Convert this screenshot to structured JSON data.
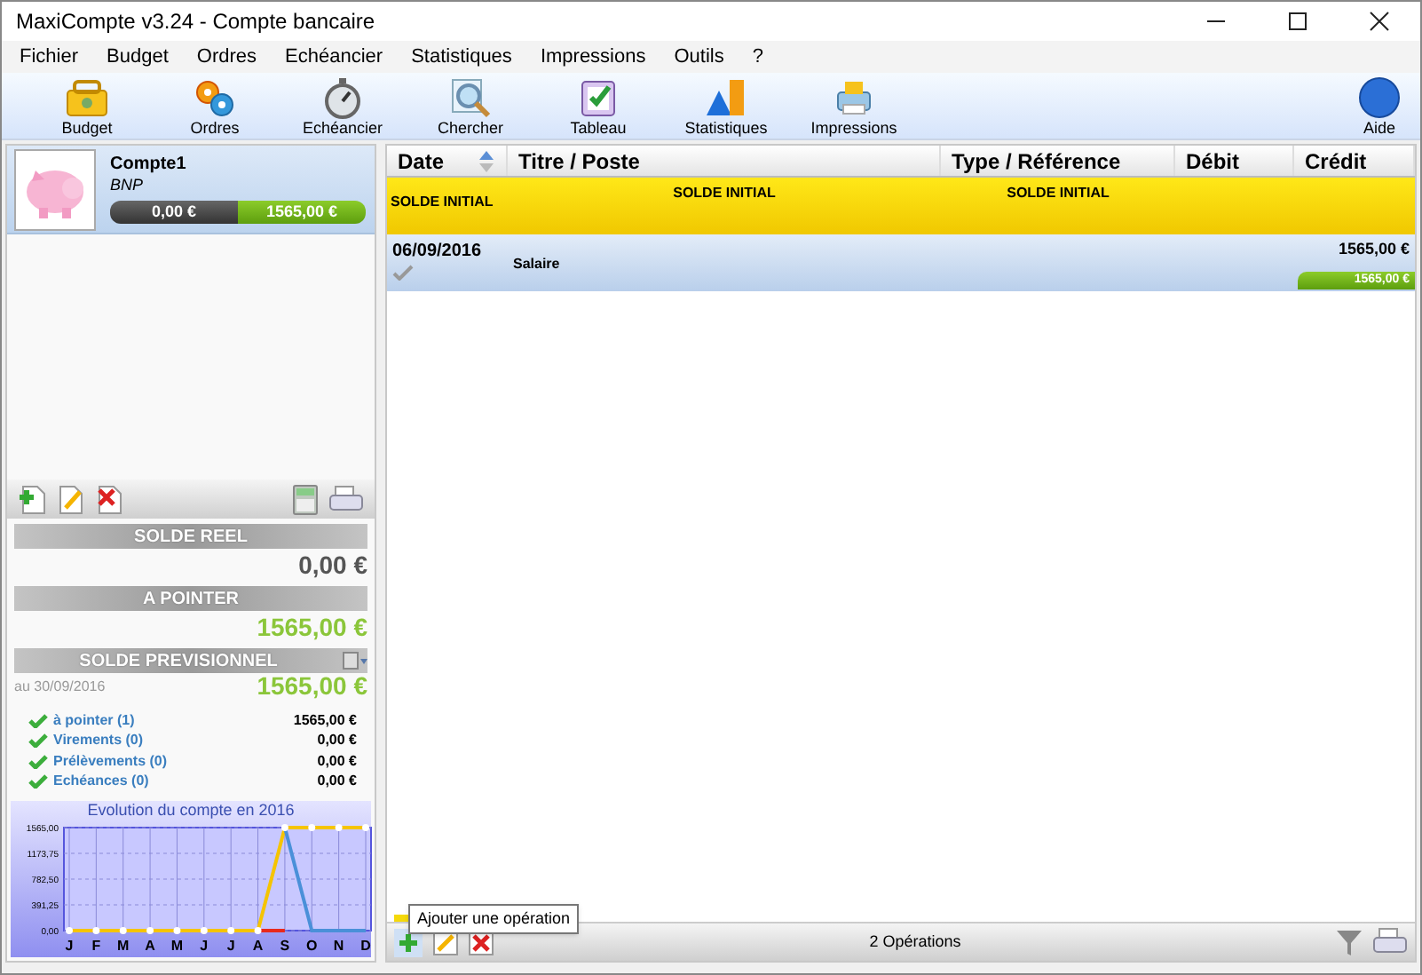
{
  "window": {
    "title": "MaxiCompte v3.24 - Compte bancaire"
  },
  "menu": [
    "Fichier",
    "Budget",
    "Ordres",
    "Echéancier",
    "Statistiques",
    "Impressions",
    "Outils",
    "?"
  ],
  "toolbar": [
    "Budget",
    "Ordres",
    "Echéancier",
    "Chercher",
    "Tableau",
    "Statistiques",
    "Impressions"
  ],
  "help": "Aide",
  "account": {
    "name": "Compte1",
    "bank": "BNP",
    "balance_left": "0,00 €",
    "balance_right": "1565,00 €"
  },
  "summary": {
    "solde_reel_label": "SOLDE REEL",
    "solde_reel": "0,00 €",
    "a_pointer_label": "A POINTER",
    "a_pointer": "1565,00 €",
    "previsionnel_label": "SOLDE PREVISIONNEL",
    "date": "au 30/09/2016",
    "previsionnel": "1565,00 €",
    "items": [
      {
        "label": "à pointer (1)",
        "amount": "1565,00 €"
      },
      {
        "label": "Virements (0)",
        "amount": "0,00 €"
      },
      {
        "label": "Prélèvements (0)",
        "amount": "0,00 €"
      },
      {
        "label": "Echéances (0)",
        "amount": "0,00 €"
      }
    ]
  },
  "chart": {
    "chart_data": {
      "type": "line",
      "title": "Evolution du compte en 2016",
      "categories": [
        "J",
        "F",
        "M",
        "A",
        "M",
        "J",
        "J",
        "A",
        "S",
        "O",
        "N",
        "D"
      ],
      "grid": true,
      "series": [
        {
          "color": "#f5c400",
          "marker": "circle",
          "values": [
            0,
            0,
            0,
            0,
            0,
            0,
            0,
            0,
            1565,
            1565,
            1565,
            1565
          ]
        },
        {
          "color": "#4a90d9",
          "values": [
            null,
            null,
            null,
            null,
            null,
            null,
            null,
            null,
            1565,
            0,
            0,
            0
          ]
        },
        {
          "color": "#e8291c",
          "values": [
            null,
            null,
            null,
            null,
            null,
            null,
            null,
            0,
            0,
            null,
            null,
            null
          ]
        }
      ],
      "ylim": [
        0,
        1565
      ],
      "yticks": [
        {
          "value": 0,
          "label": "0,00"
        },
        {
          "value": 391.25,
          "label": "391,25"
        },
        {
          "value": 782.5,
          "label": "782,50"
        },
        {
          "value": 1173.75,
          "label": "1173,75"
        },
        {
          "value": 1565,
          "label": "1565,00"
        }
      ]
    }
  },
  "table": {
    "columns": [
      "Date",
      "Titre / Poste",
      "Type / Référence",
      "Débit",
      "Crédit"
    ],
    "rows": [
      {
        "kind": "initial",
        "date": "SOLDE INITIAL",
        "title": "SOLDE INITIAL",
        "type": "SOLDE INITIAL"
      },
      {
        "kind": "operation",
        "date": "06/09/2016",
        "title": "Salaire",
        "credit": "1565,00 €",
        "credit_badge": "1565,00 €"
      }
    ]
  },
  "status_bar": {
    "count": "2 Opérations",
    "tooltip": "Ajouter une opération"
  }
}
